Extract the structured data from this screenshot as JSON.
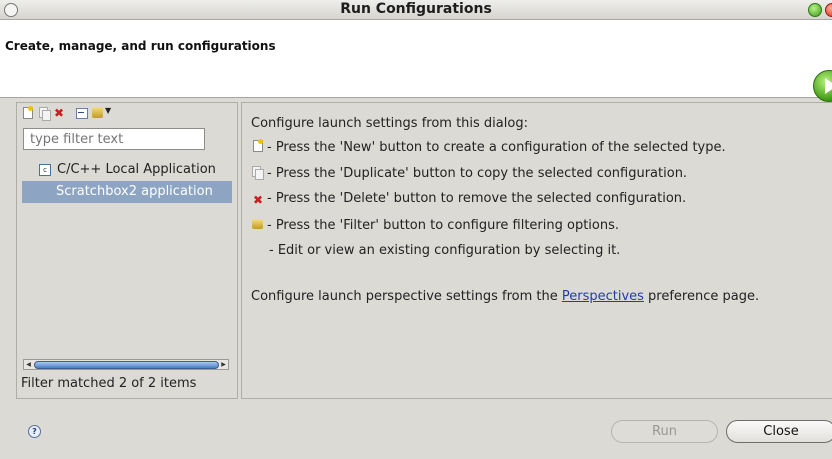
{
  "window": {
    "title": "Run Configurations"
  },
  "header": {
    "title": "Create, manage, and run configurations"
  },
  "left_pane": {
    "toolbar_icons": [
      "new-config-icon",
      "duplicate-config-icon",
      "delete-config-icon",
      "collapse-all-icon",
      "filter-icon"
    ],
    "filter": {
      "placeholder": "type filter text",
      "value": ""
    },
    "tree": [
      {
        "label": "C/C++ Local Application",
        "icon": "c-app-icon",
        "children": [
          {
            "label": "Scratchbox2 application",
            "selected": true
          }
        ]
      }
    ],
    "status": "Filter matched 2 of 2 items"
  },
  "right_pane": {
    "intro": "Configure launch settings from this dialog:",
    "lines": [
      {
        "icon": "new-icon",
        "text": "- Press the 'New' button to create a configuration of the selected type."
      },
      {
        "icon": "duplicate-icon",
        "text": "- Press the 'Duplicate' button to copy the selected configuration."
      },
      {
        "icon": "delete-icon",
        "text": "- Press the 'Delete' button to remove the selected configuration."
      },
      {
        "icon": "filter-icon",
        "text": "- Press the 'Filter' button to configure filtering options."
      },
      {
        "icon": "",
        "text": "- Edit or view an existing configuration by selecting it."
      }
    ],
    "perspective": {
      "prefix": "Configure launch perspective settings from the ",
      "link": "Perspectives",
      "suffix": " preference page."
    }
  },
  "buttons": {
    "run": "Run",
    "close": "Close"
  },
  "colors": {
    "selection": "#8da4c2",
    "link": "#1f3fa8",
    "dialog_bg": "#dcdad5"
  }
}
